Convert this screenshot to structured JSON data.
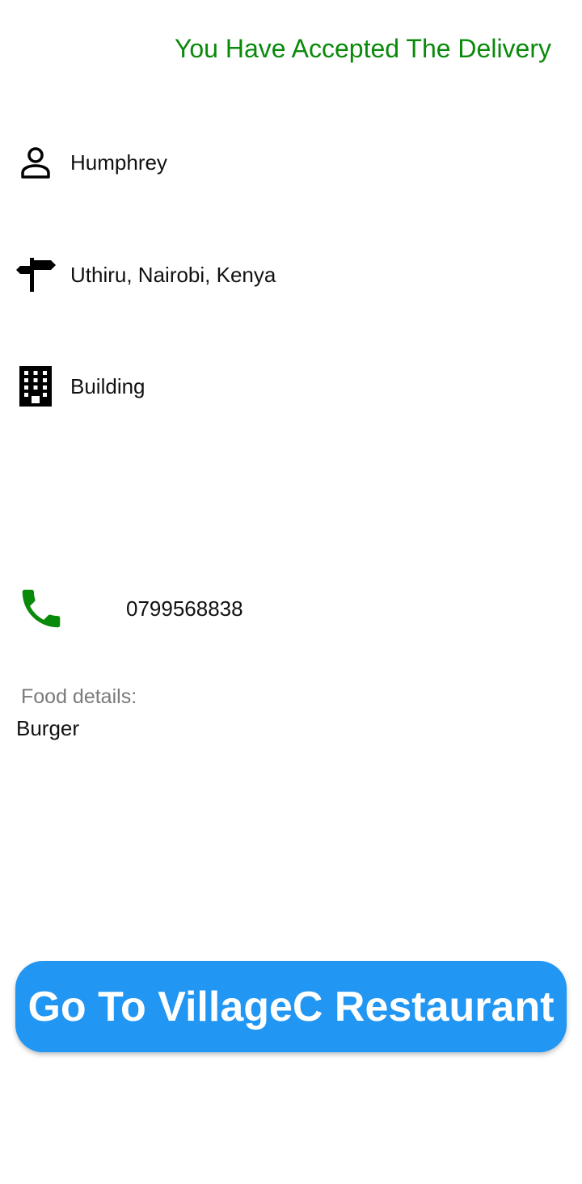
{
  "status": {
    "title": "You Have Accepted The Delivery",
    "color": "#0a8a0a"
  },
  "customer": {
    "name": "Humphrey",
    "icon": "person-icon"
  },
  "location": {
    "address": "Uthiru, Nairobi, Kenya",
    "icon": "signpost-icon"
  },
  "building": {
    "label": "Building",
    "icon": "building-icon"
  },
  "phone": {
    "number": "0799568838",
    "icon": "phone-icon",
    "color": "#0a8a0a"
  },
  "food": {
    "label": "Food details:",
    "value": "Burger"
  },
  "action": {
    "button_label": "Go To VillageC Restaurant",
    "color": "#2196f3"
  }
}
